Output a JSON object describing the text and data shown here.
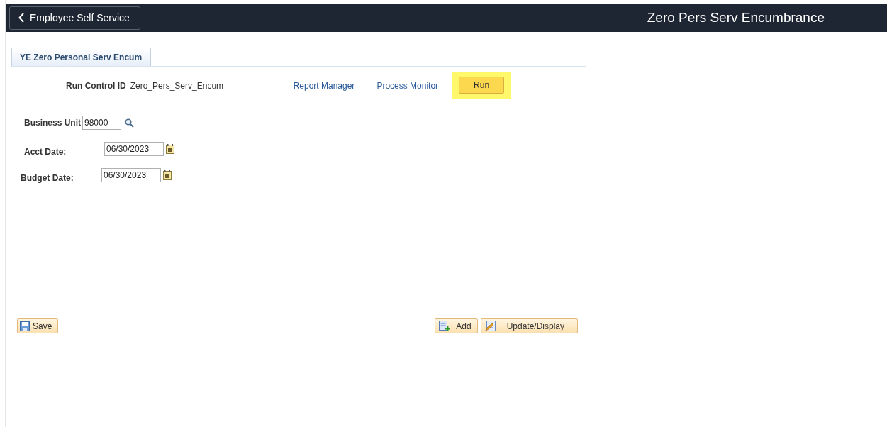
{
  "header": {
    "back_button": "Employee Self Service",
    "title": "Zero Pers Serv Encumbrance"
  },
  "tabs": [
    {
      "label": "YE Zero Personal Serv Encum",
      "selected": true
    }
  ],
  "run_control": {
    "label": "Run Control ID",
    "value": "Zero_Pers_Serv_Encum",
    "links": [
      "Report Manager",
      "Process Monitor"
    ],
    "run_button": {
      "label": "Run",
      "highlighted": true
    }
  },
  "fields": [
    {
      "label": "Business Unit",
      "value": "98000",
      "kind": "lookup"
    },
    {
      "label": "Acct Date:",
      "value": "06/30/2023",
      "kind": "date"
    },
    {
      "label": "Budget Date:",
      "value": "06/30/2023",
      "kind": "date"
    }
  ],
  "footer_buttons": [
    {
      "label": "Save",
      "kind": "save"
    },
    {
      "label": "Add",
      "kind": "add"
    },
    {
      "label": "Update/Display",
      "kind": "update"
    }
  ]
}
